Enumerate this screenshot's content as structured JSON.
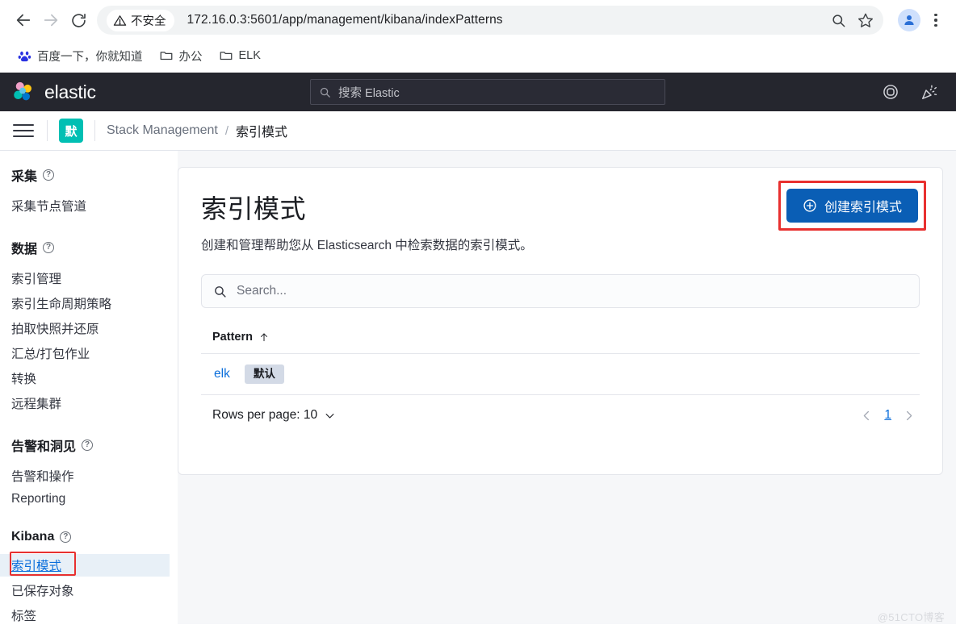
{
  "browser": {
    "back_label": "back-arrow",
    "forward_label": "forward-arrow",
    "reload_label": "reload",
    "security_label": "不安全",
    "url": "172.16.0.3:5601/app/management/kibana/indexPatterns",
    "bookmarks": [
      {
        "label": "百度一下，你就知道",
        "icon": "baidu-paw-icon"
      },
      {
        "label": "办公",
        "icon": "folder-icon"
      },
      {
        "label": "ELK",
        "icon": "folder-icon"
      }
    ]
  },
  "elastic_header": {
    "brand": "elastic",
    "search_placeholder": "搜索 Elastic",
    "icons": [
      "globe-icon",
      "celebration-icon"
    ]
  },
  "breadcrumb": {
    "space_badge": "默",
    "items": [
      {
        "label": "Stack Management",
        "active": false
      },
      {
        "label": "索引模式",
        "active": true
      }
    ],
    "separator": "/"
  },
  "sidebar": {
    "groups": [
      {
        "title": "采集",
        "has_help": true,
        "items": [
          {
            "label": "采集节点管道",
            "selected": false
          }
        ]
      },
      {
        "title": "数据",
        "has_help": true,
        "items": [
          {
            "label": "索引管理",
            "selected": false
          },
          {
            "label": "索引生命周期策略",
            "selected": false
          },
          {
            "label": "拍取快照并还原",
            "selected": false
          },
          {
            "label": "汇总/打包作业",
            "selected": false
          },
          {
            "label": "转换",
            "selected": false
          },
          {
            "label": "远程集群",
            "selected": false
          }
        ]
      },
      {
        "title": "告警和洞见",
        "has_help": true,
        "items": [
          {
            "label": "告警和操作",
            "selected": false
          },
          {
            "label": "Reporting",
            "selected": false
          }
        ]
      },
      {
        "title": "Kibana",
        "has_help": true,
        "items": [
          {
            "label": "索引模式",
            "selected": true
          },
          {
            "label": "已保存对象",
            "selected": false
          },
          {
            "label": "标签",
            "selected": false
          }
        ]
      }
    ]
  },
  "main": {
    "title": "索引模式",
    "description": "创建和管理帮助您从 Elasticsearch 中检索数据的索引模式。",
    "create_button": "创建索引模式",
    "search_placeholder": "Search...",
    "table": {
      "columns": [
        "Pattern"
      ],
      "sort_direction": "asc",
      "rows": [
        {
          "pattern": "elk",
          "badge": "默认"
        }
      ]
    },
    "rows_per_page_label": "Rows per page: 10",
    "pagination": {
      "current": "1",
      "prev": "‹",
      "next": "›"
    }
  },
  "watermark": "@51CTO博客",
  "colors": {
    "accent_blue": "#0a5eb5",
    "link_blue": "#0a6edb",
    "highlight_red": "#e8302f",
    "space_teal": "#00bfb3",
    "header_dark": "#25262e"
  }
}
